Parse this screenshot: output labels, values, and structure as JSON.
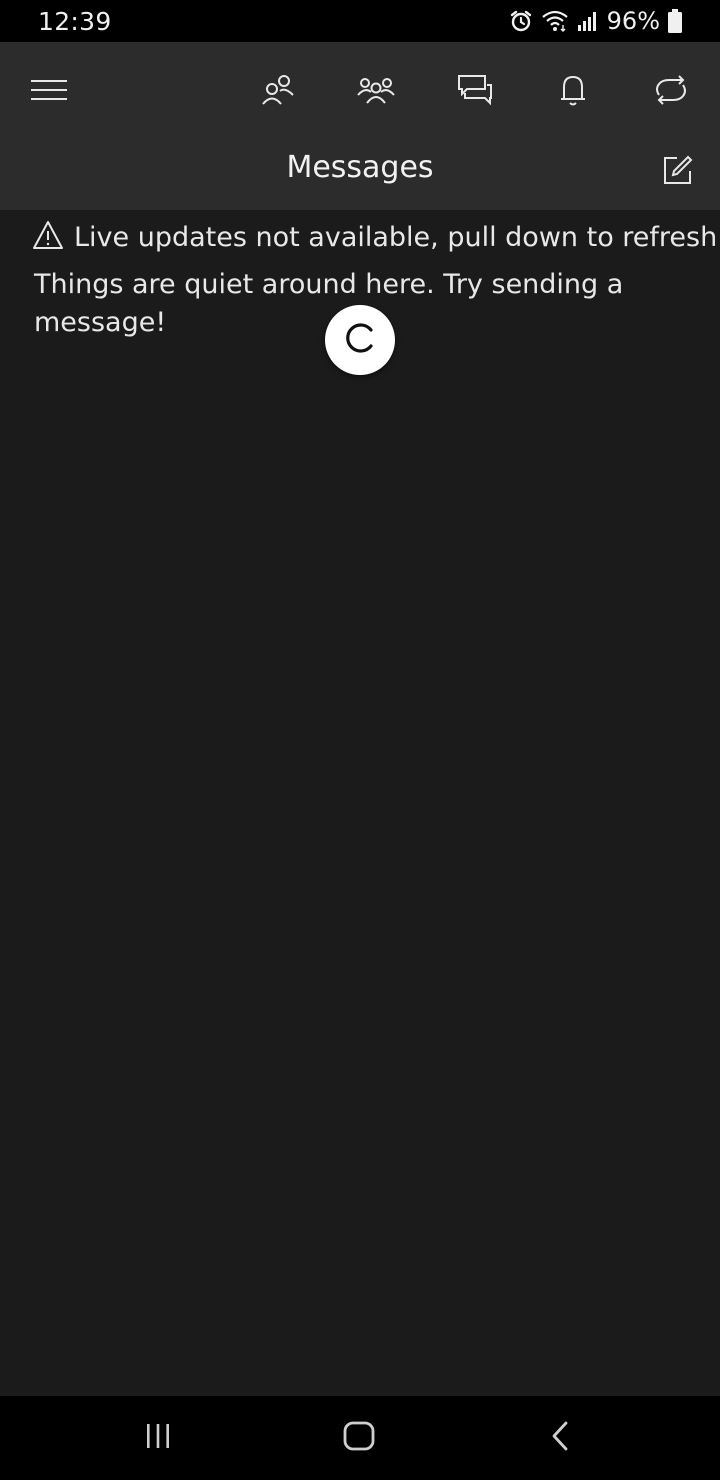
{
  "status_bar": {
    "time": "12:39",
    "battery": "96%"
  },
  "toolbar": {
    "icons": [
      "menu-icon",
      "friends-icon",
      "party-icon",
      "chat-icon",
      "notifications-icon",
      "refresh-icon"
    ]
  },
  "header": {
    "title": "Messages"
  },
  "content": {
    "warning": "Live updates not available, pull down to refresh",
    "empty_state": "Things are quiet around here. Try sending a message!"
  },
  "colors": {
    "status_bar": "#000000",
    "header": "#2c2c2c",
    "background": "#1b1b1b",
    "text": "#e8e8e8"
  }
}
